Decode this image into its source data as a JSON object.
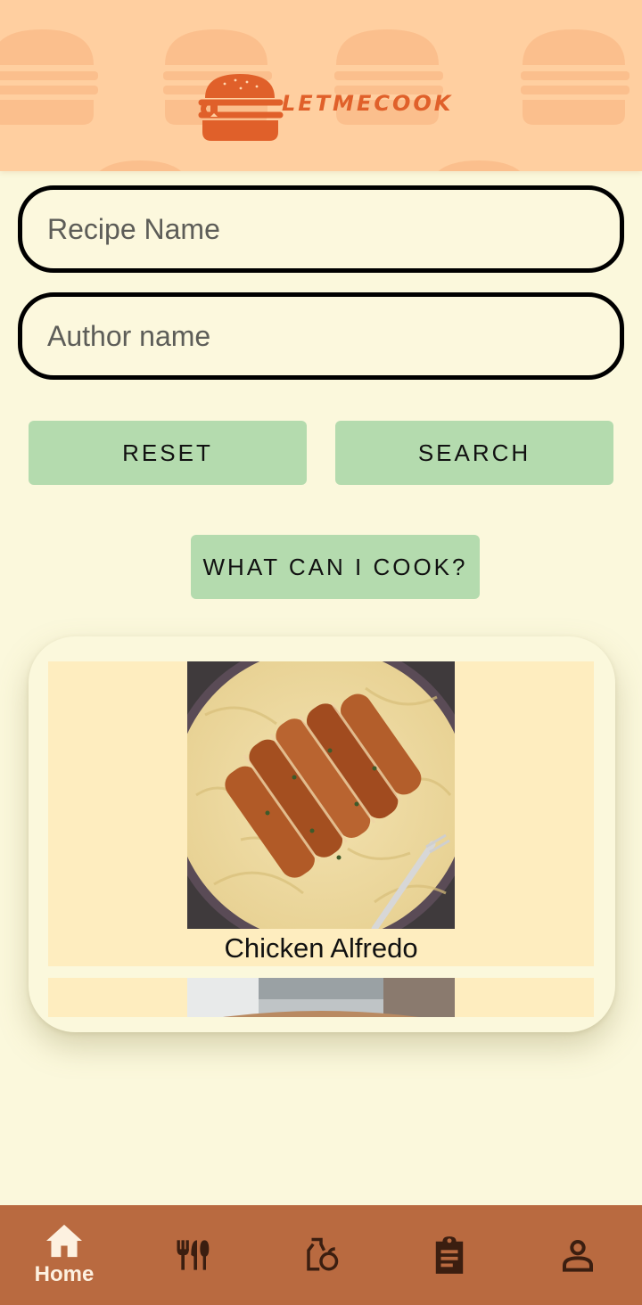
{
  "app": {
    "logo_text": "LETMECOOK"
  },
  "search": {
    "recipe_placeholder": "Recipe Name",
    "author_placeholder": "Author name",
    "reset_label": "RESET",
    "search_label": "SEARCH",
    "cook_label": "WHAT CAN I COOK?"
  },
  "results": [
    {
      "title": "Chicken Alfredo"
    }
  ],
  "nav": {
    "items": [
      {
        "label": "Home",
        "icon": "home-icon",
        "active": true
      },
      {
        "label": "",
        "icon": "recipes-utensils-icon"
      },
      {
        "label": "",
        "icon": "pantry-icon"
      },
      {
        "label": "",
        "icon": "clipboard-icon"
      },
      {
        "label": "",
        "icon": "profile-icon"
      }
    ]
  },
  "colors": {
    "background": "#fbf8dc",
    "header": "#ffcfa0",
    "button": "#b4dbae",
    "nav": "#b96a40",
    "accent": "#e0602a"
  }
}
